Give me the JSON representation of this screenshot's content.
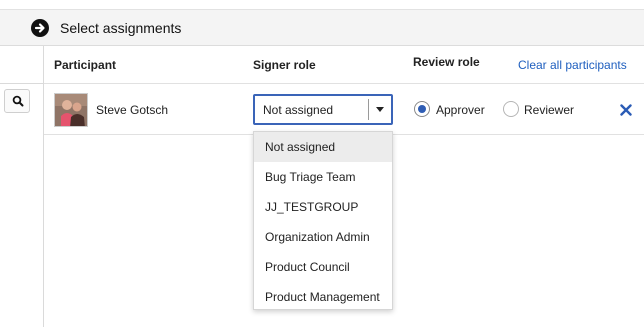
{
  "header": {
    "title": "Select assignments",
    "icon": "arrow-right-circle-icon"
  },
  "sidebar": {
    "search_icon": "search-icon"
  },
  "table": {
    "columns": {
      "participant": "Participant",
      "signer_role": "Signer role",
      "review_role": "Review role"
    },
    "clear_all_label": "Clear all participants",
    "rows": [
      {
        "name": "Steve Gotsch",
        "signer_role": "Not assigned",
        "review_options": [
          "Approver",
          "Reviewer"
        ],
        "review_selected": "Approver"
      }
    ]
  },
  "dropdown": {
    "options": [
      "Not assigned",
      "Bug Triage Team",
      "JJ_TESTGROUP",
      "Organization Admin",
      "Product Council",
      "Product Management"
    ],
    "selected": "Not assigned"
  },
  "colors": {
    "accent": "#3a64b8",
    "link": "#1f5fbf",
    "radio_selected": "#2f5db4",
    "remove": "#2a5bb5"
  }
}
